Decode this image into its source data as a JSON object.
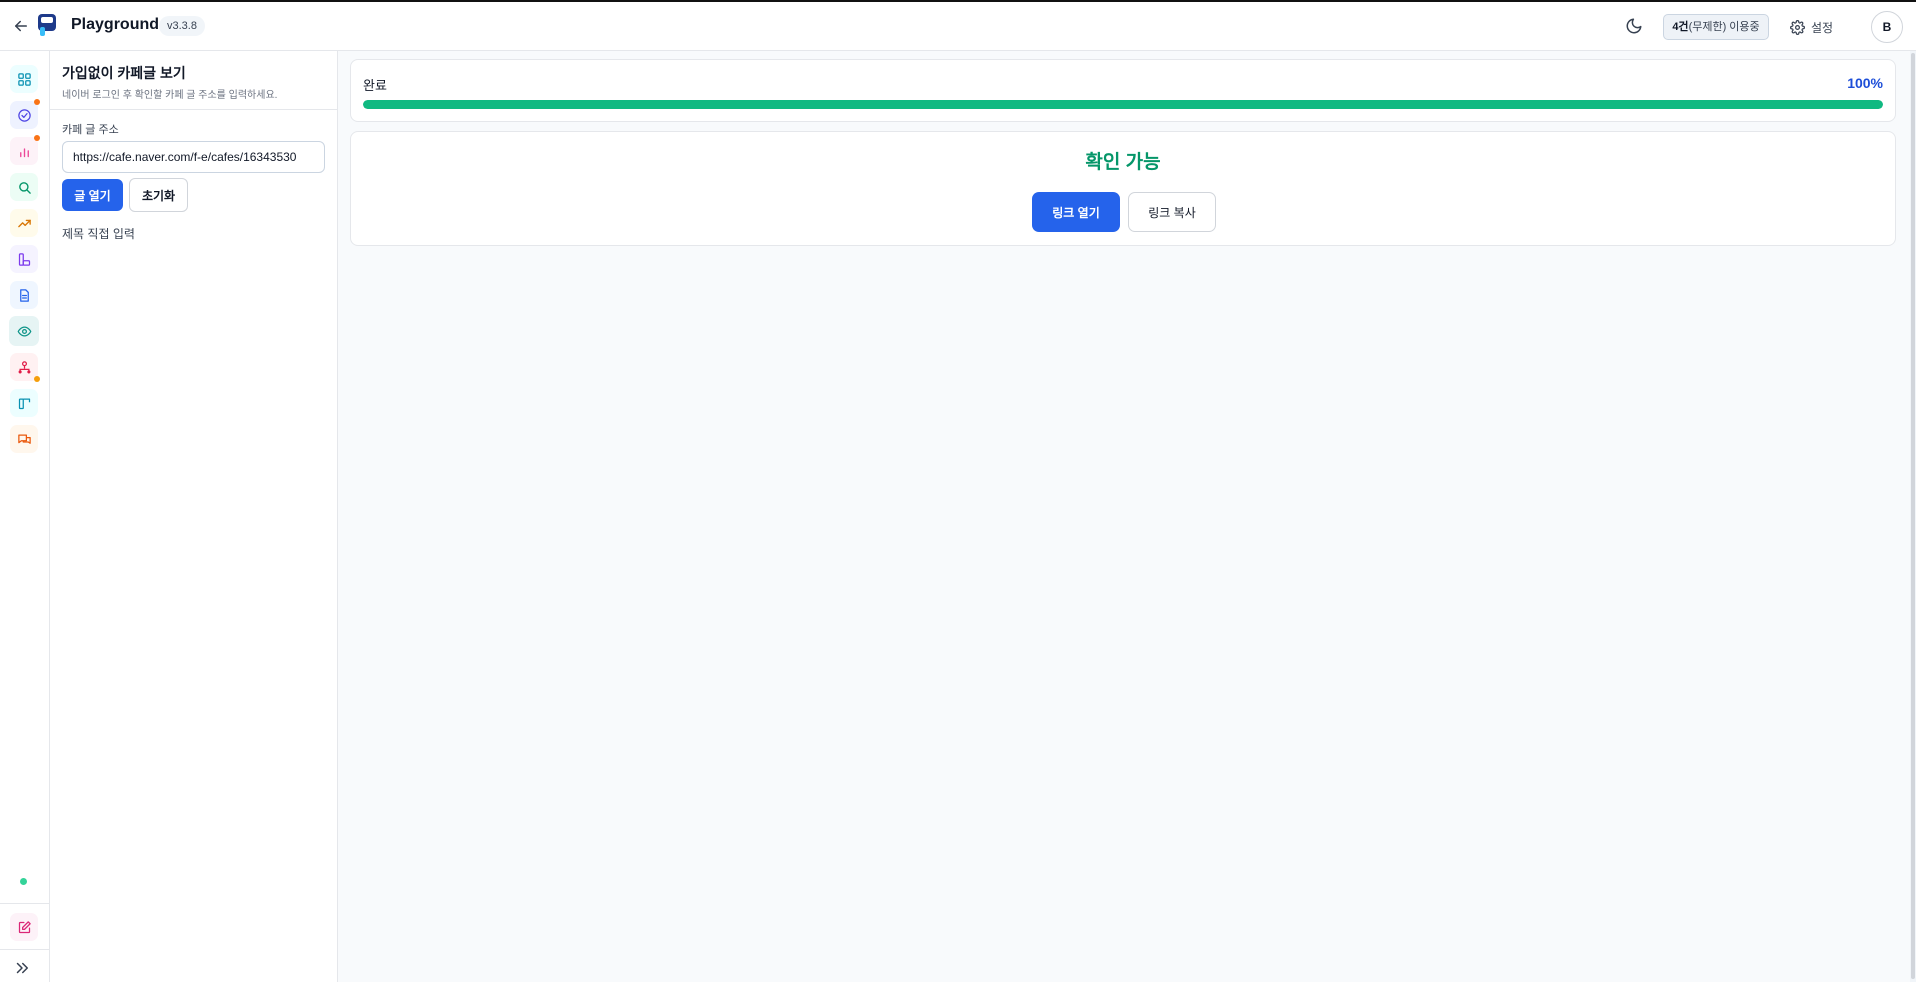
{
  "header": {
    "app_title": "Playground",
    "version": "v3.3.8",
    "usage_count": "4건",
    "usage_status": "(무제한) 이용중",
    "settings_label": "설정",
    "avatar_initial": "B"
  },
  "sidebar": {
    "items": [
      {
        "icon": "grid-icon",
        "color": "#0891b2",
        "bg": "#ecfeff"
      },
      {
        "icon": "check-circle-icon",
        "color": "#4f46e5",
        "bg": "#eef2ff",
        "badge": true
      },
      {
        "icon": "bar-chart-icon",
        "color": "#ec4899",
        "bg": "#fdf2f8",
        "badge": true
      },
      {
        "icon": "search-icon",
        "color": "#059669",
        "bg": "#ecfdf5"
      },
      {
        "icon": "trending-up-icon",
        "color": "#d97706",
        "bg": "#fffbeb"
      },
      {
        "icon": "layout-icon",
        "color": "#7c3aed",
        "bg": "#f5f3ff"
      },
      {
        "icon": "document-icon",
        "color": "#2563eb",
        "bg": "#eff6ff"
      },
      {
        "icon": "eye-icon",
        "color": "#0d9488",
        "bg": "#e6f4f4",
        "active": true
      },
      {
        "icon": "network-icon",
        "color": "#e11d48",
        "bg": "#fff1f2",
        "badge": true
      },
      {
        "icon": "panel-icon",
        "color": "#0891b2",
        "bg": "#ecfeff"
      },
      {
        "icon": "chat-icon",
        "color": "#ea580c",
        "bg": "#fff7ed"
      }
    ],
    "edit_icon": "edit-icon",
    "expand_icon": "chevrons-right-icon"
  },
  "panel": {
    "title": "가입없이 카페글 보기",
    "subtitle": "네이버 로그인 후 확인할 카페 글 주소를 입력하세요.",
    "url_label": "카페 글 주소",
    "url_value": "https://cafe.naver.com/f-e/cafes/16343530",
    "open_button": "글 열기",
    "reset_button": "초기화",
    "manual_title": "제목 직접 입력"
  },
  "progress": {
    "label": "완료",
    "percent_text": "100%",
    "fraction": 1.0
  },
  "result": {
    "status": "확인 가능",
    "open_link_button": "링크 열기",
    "copy_link_button": "링크 복사"
  },
  "colors": {
    "accent": "#2563eb",
    "success": "#059669",
    "progress_fill": "#10b981"
  }
}
